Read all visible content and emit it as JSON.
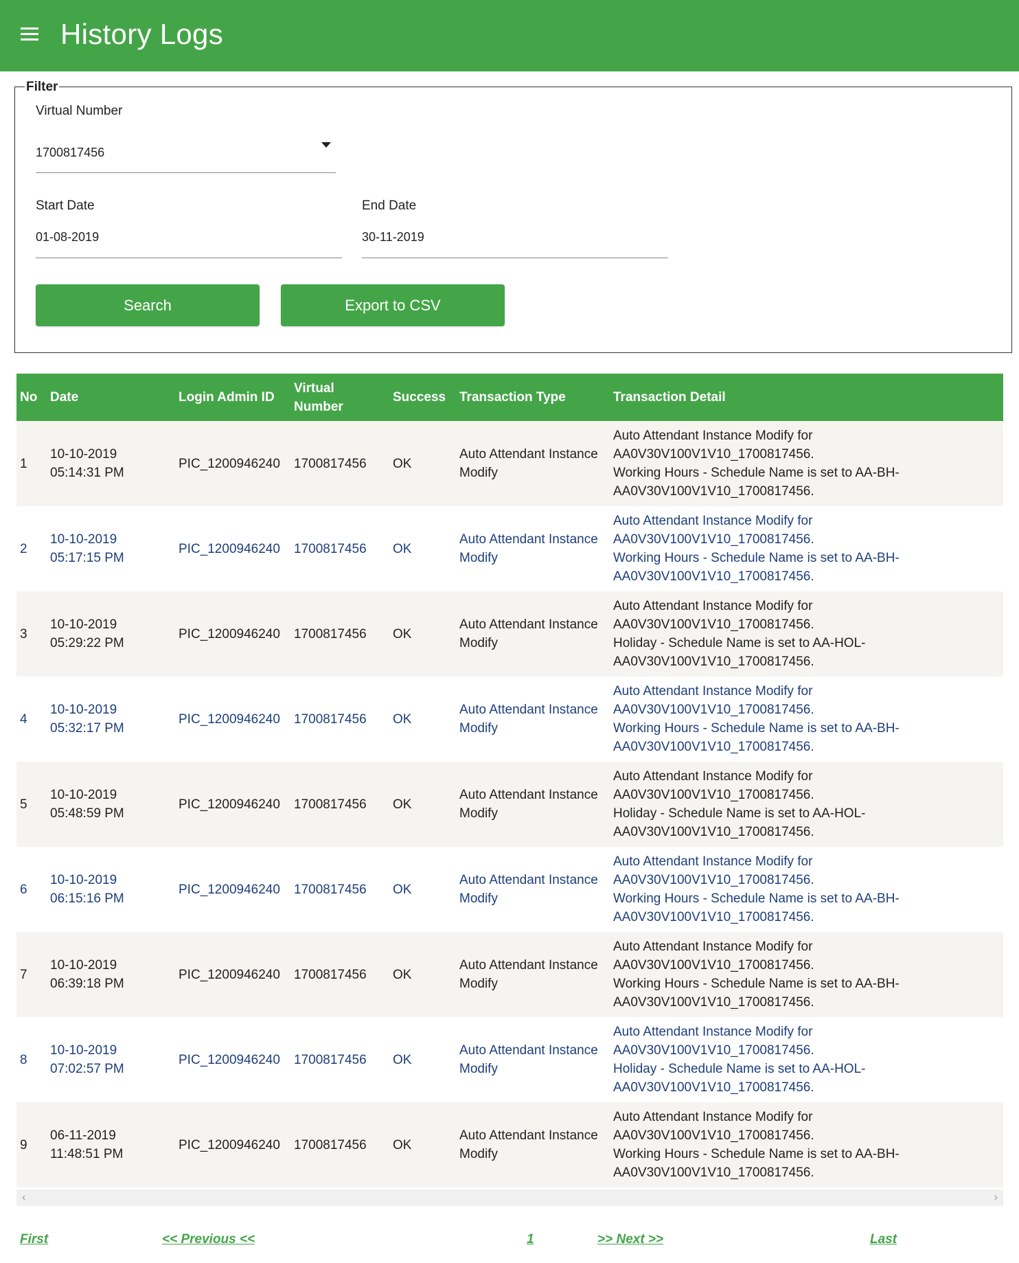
{
  "header": {
    "title": "History Logs",
    "menu_icon": "hamburger-menu-icon"
  },
  "filter": {
    "legend": "Filter",
    "virtual_number_label": "Virtual Number",
    "virtual_number_value": "1700817456",
    "start_date_label": "Start Date",
    "start_date_value": "01-08-2019",
    "end_date_label": "End Date",
    "end_date_value": "30-11-2019",
    "search_button": "Search",
    "export_button": "Export to CSV"
  },
  "table": {
    "headers": [
      "No",
      "Date",
      "Login Admin ID",
      "Virtual Number",
      "Success",
      "Transaction Type",
      "Transaction Detail"
    ],
    "rows": [
      {
        "no": "1",
        "date": "10-10-2019",
        "time": "05:14:31 PM",
        "admin": "PIC_1200946240",
        "vnum": "1700817456",
        "success": "OK",
        "type": "Auto Attendant Instance Modify",
        "d1": "Auto Attendant Instance Modify for",
        "d2": "AA0V30V100V1V10_1700817456.",
        "d3": "Working Hours - Schedule Name is set to AA-BH-",
        "d4": "AA0V30V100V1V10_1700817456."
      },
      {
        "no": "2",
        "date": "10-10-2019",
        "time": "05:17:15 PM",
        "admin": "PIC_1200946240",
        "vnum": "1700817456",
        "success": "OK",
        "type": "Auto Attendant Instance Modify",
        "d1": "Auto Attendant Instance Modify for",
        "d2": "AA0V30V100V1V10_1700817456.",
        "d3": "Working Hours - Schedule Name is set to AA-BH-",
        "d4": "AA0V30V100V1V10_1700817456."
      },
      {
        "no": "3",
        "date": "10-10-2019",
        "time": "05:29:22 PM",
        "admin": "PIC_1200946240",
        "vnum": "1700817456",
        "success": "OK",
        "type": "Auto Attendant Instance Modify",
        "d1": "Auto Attendant Instance Modify for",
        "d2": "AA0V30V100V1V10_1700817456.",
        "d3": "Holiday - Schedule Name is set to AA-HOL-",
        "d4": "AA0V30V100V1V10_1700817456."
      },
      {
        "no": "4",
        "date": "10-10-2019",
        "time": "05:32:17 PM",
        "admin": "PIC_1200946240",
        "vnum": "1700817456",
        "success": "OK",
        "type": "Auto Attendant Instance Modify",
        "d1": "Auto Attendant Instance Modify for",
        "d2": "AA0V30V100V1V10_1700817456.",
        "d3": "Working Hours - Schedule Name is set to AA-BH-",
        "d4": "AA0V30V100V1V10_1700817456."
      },
      {
        "no": "5",
        "date": "10-10-2019",
        "time": "05:48:59 PM",
        "admin": "PIC_1200946240",
        "vnum": "1700817456",
        "success": "OK",
        "type": "Auto Attendant Instance Modify",
        "d1": "Auto Attendant Instance Modify for",
        "d2": "AA0V30V100V1V10_1700817456.",
        "d3": "Holiday - Schedule Name is set to AA-HOL-",
        "d4": "AA0V30V100V1V10_1700817456."
      },
      {
        "no": "6",
        "date": "10-10-2019",
        "time": "06:15:16 PM",
        "admin": "PIC_1200946240",
        "vnum": "1700817456",
        "success": "OK",
        "type": "Auto Attendant Instance Modify",
        "d1": "Auto Attendant Instance Modify for",
        "d2": "AA0V30V100V1V10_1700817456.",
        "d3": "Working Hours - Schedule Name is set to AA-BH-",
        "d4": "AA0V30V100V1V10_1700817456."
      },
      {
        "no": "7",
        "date": "10-10-2019",
        "time": "06:39:18 PM",
        "admin": "PIC_1200946240",
        "vnum": "1700817456",
        "success": "OK",
        "type": "Auto Attendant Instance Modify",
        "d1": "Auto Attendant Instance Modify for",
        "d2": "AA0V30V100V1V10_1700817456.",
        "d3": "Working Hours - Schedule Name is set to AA-BH-",
        "d4": "AA0V30V100V1V10_1700817456."
      },
      {
        "no": "8",
        "date": "10-10-2019",
        "time": "07:02:57 PM",
        "admin": "PIC_1200946240",
        "vnum": "1700817456",
        "success": "OK",
        "type": "Auto Attendant Instance Modify",
        "d1": "Auto Attendant Instance Modify for",
        "d2": "AA0V30V100V1V10_1700817456.",
        "d3": "Holiday - Schedule Name is set to AA-HOL-",
        "d4": "AA0V30V100V1V10_1700817456."
      },
      {
        "no": "9",
        "date": "06-11-2019",
        "time": "11:48:51 PM",
        "admin": "PIC_1200946240",
        "vnum": "1700817456",
        "success": "OK",
        "type": "Auto Attendant Instance Modify",
        "d1": "Auto Attendant Instance Modify for",
        "d2": "AA0V30V100V1V10_1700817456.",
        "d3": "Working Hours - Schedule Name is set to AA-BH-",
        "d4": "AA0V30V100V1V10_1700817456."
      }
    ]
  },
  "pager": {
    "first": "First",
    "previous": "<< Previous <<",
    "page": "1",
    "next": ">> Next >>",
    "last": "Last"
  },
  "colors": {
    "accent": "#44a548",
    "row_alt": "#f5f4f0",
    "link_text": "#1e3f7a"
  }
}
